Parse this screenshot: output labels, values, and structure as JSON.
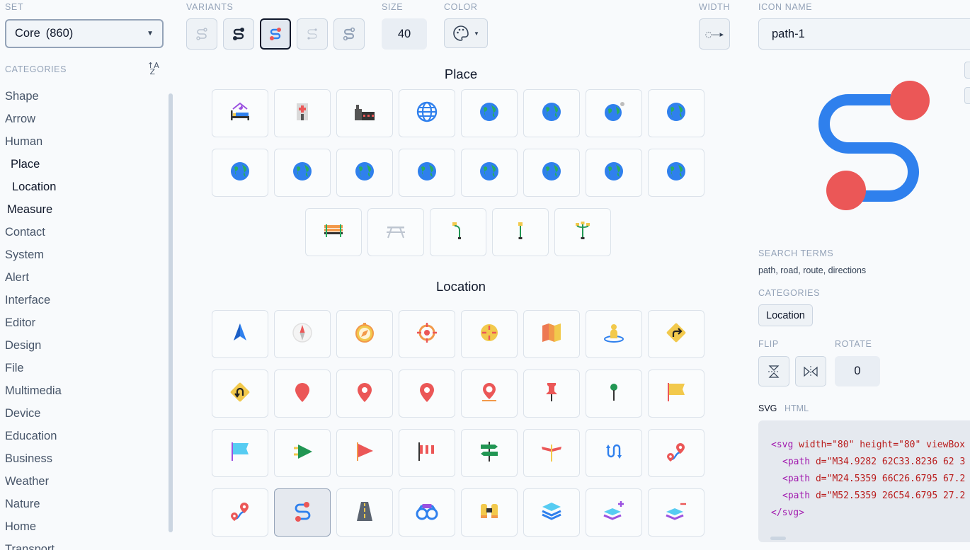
{
  "labels": {
    "set": "SET",
    "variants": "VARIANTS",
    "size": "SIZE",
    "color": "COLOR",
    "width": "WIDTH",
    "icon_name": "ICON NAME",
    "categories": "CATEGORIES",
    "search_terms": "SEARCH TERMS",
    "categories_right": "CATEGORIES",
    "flip": "FLIP",
    "rotate": "ROTATE"
  },
  "set_select": {
    "name": "Core",
    "count": "(860)"
  },
  "size_value": "40",
  "categories": [
    "Shape",
    "Arrow",
    "Human",
    "Place",
    "Location",
    "Measure",
    "Contact",
    "System",
    "Alert",
    "Interface",
    "Editor",
    "Design",
    "File",
    "Multimedia",
    "Device",
    "Education",
    "Business",
    "Weather",
    "Nature",
    "Home",
    "Transport"
  ],
  "sections": {
    "place": "Place",
    "location": "Location"
  },
  "icon_name_value": "path-1",
  "search_terms_value": "path, road, route, directions",
  "category_chip": "Location",
  "rotate_value": "0",
  "tabs": {
    "svg": "SVG",
    "html": "HTML"
  },
  "code": {
    "line1_tag": "<svg",
    "line1_rest": " width=\"80\" height=\"80\" viewBox",
    "line2_tag": "<path",
    "line2_rest": " d=\"M34.9282 62C33.8236 62 3",
    "line3_tag": "<path",
    "line3_rest": " d=\"M24.5359 66C26.6795 67.2",
    "line4_tag": "<path",
    "line4_rest": " d=\"M52.5359 26C54.6795 27.2",
    "line5": "</svg>"
  },
  "colors": {
    "accent_blue": "#2f80ed",
    "accent_red": "#eb5757",
    "green": "#27ae60",
    "yellow": "#f2c94c",
    "orange": "#f2994a"
  },
  "place_icons": [
    "hotel-bed-icon",
    "hospital-icon",
    "factory-icon",
    "globe-grid-icon",
    "earth-icon",
    "earth-icon",
    "earth-dot-icon",
    "earth-icon",
    "earth-icon",
    "earth-icon",
    "earth-icon",
    "earth-icon",
    "earth-icon",
    "earth-icon",
    "earth-icon",
    "earth-icon",
    "bench-icon",
    "picnic-table-icon",
    "street-lamp-icon",
    "lamp-post-icon",
    "double-lamp-icon"
  ],
  "location_icons": [
    "navigation-arrow-icon",
    "compass-needle-icon",
    "compass-icon",
    "target-icon",
    "crosshair-icon",
    "map-icon",
    "person-location-icon",
    "turn-right-sign-icon",
    "u-turn-sign-icon",
    "map-pin-icon",
    "map-pin-dot-icon",
    "map-pin-dot-icon",
    "map-pin-ground-icon",
    "push-pin-icon",
    "pin-green-icon",
    "flag-yellow-icon",
    "flag-blue-icon",
    "pennant-green-icon",
    "flag-red-icon",
    "windsock-icon",
    "signpost-icon",
    "direction-sign-icon",
    "route-loop-icon",
    "route-pin-icon",
    "route-pin-icon",
    "path-icon",
    "road-icon",
    "binoculars-icon",
    "binoculars-icon",
    "layers-icon",
    "layers-add-icon",
    "layers-remove-icon"
  ]
}
